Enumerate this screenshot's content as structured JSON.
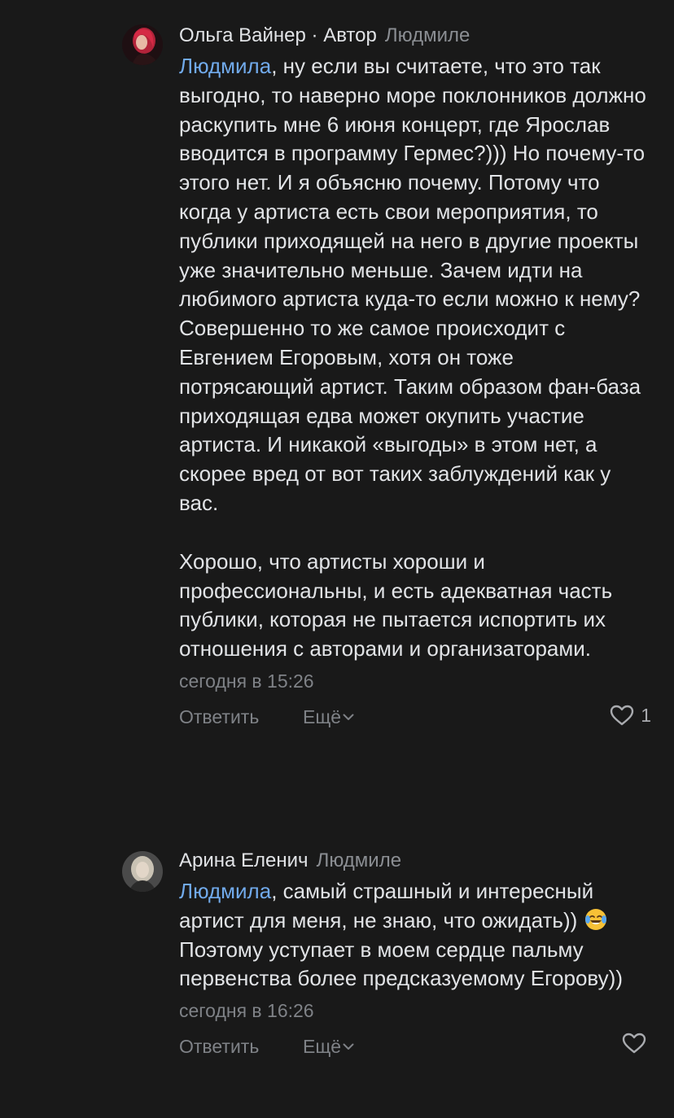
{
  "comments": [
    {
      "author": "Ольга Вайнер · Автор",
      "reply_to": "Людмиле",
      "mention": "Людмила",
      "paragraphs": [
        ", ну если вы считаете, что это так выгодно, то наверно море поклонников должно раскупить мне 6 июня концерт, где Ярослав вводится в программу Гермес?))) Но почему-то этого нет. И я объясню почему. Потому что когда у артиста есть свои мероприятия, то публики приходящей на него в другие проекты уже значительно меньше. Зачем идти на любимого артиста куда-то если можно к нему? Совершенно то же самое происходит с Евгением Егоровым, хотя он тоже потрясающий артист. Таким образом фан-база приходящая едва может окупить участие артиста. И никакой «выгоды» в этом нет, а скорее вред от вот таких заблуждений как у вас.",
        "Хорошо, что артисты хороши и профессиональны, и есть адекватная часть публики, которая не пытается испортить их отношения с авторами и организаторами."
      ],
      "time": "сегодня в 15:26",
      "reply_label": "Ответить",
      "more_label": "Ещё",
      "likes": "1",
      "avatar_icon": "avatar-photo-red-hair"
    },
    {
      "author": "Арина Еленич",
      "reply_to": "Людмиле",
      "mention": "Людмила",
      "text_line1": ", самый страшный и интересный артист для меня, не знаю, что ожидать))",
      "emoji_icon": "face-with-tears-of-joy-icon",
      "text_line2": "Поэтому уступает в моем сердце пальму первенства более предсказуемому Егорову))",
      "time": "сегодня в 16:26",
      "reply_label": "Ответить",
      "more_label": "Ещё",
      "likes": "",
      "avatar_icon": "avatar-photo-blonde"
    }
  ],
  "colors": {
    "background": "#191919",
    "text": "#e1e3e6",
    "secondary": "#7f8287",
    "mention": "#71aaeb"
  }
}
